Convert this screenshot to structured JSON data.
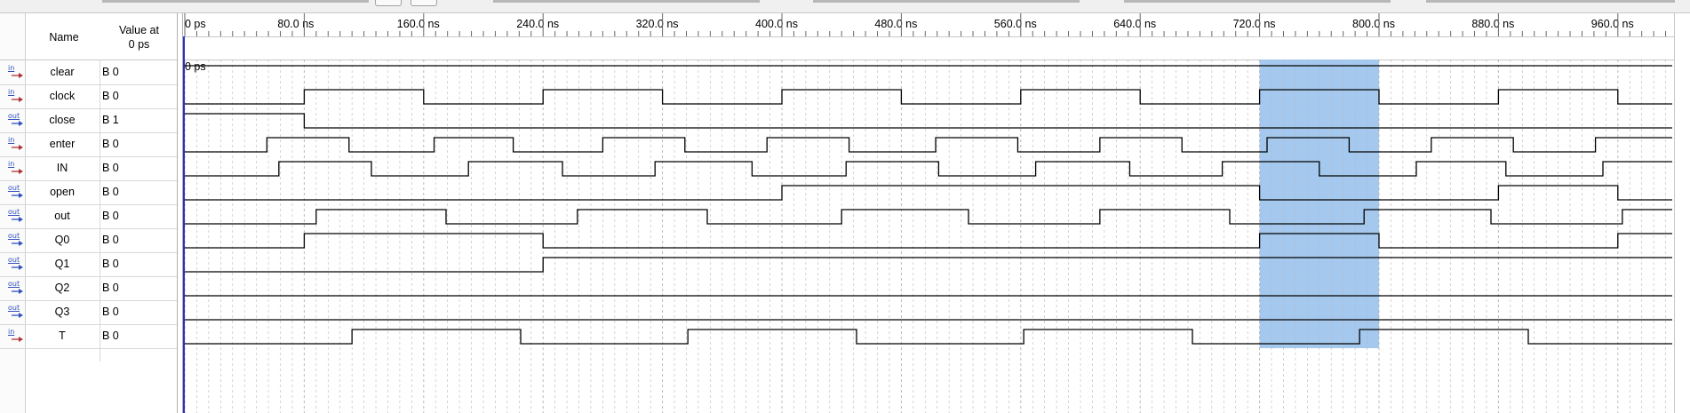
{
  "signal_panel": {
    "name_header": "Name",
    "value_header_line1": "Value at",
    "value_header_line2": "0 ps"
  },
  "signals": [
    {
      "dir": "in",
      "name": "clear",
      "value": "B 0"
    },
    {
      "dir": "in",
      "name": "clock",
      "value": "B 0"
    },
    {
      "dir": "out",
      "name": "close",
      "value": "B 1"
    },
    {
      "dir": "in",
      "name": "enter",
      "value": "B 0"
    },
    {
      "dir": "in",
      "name": "IN",
      "value": "B 0"
    },
    {
      "dir": "out",
      "name": "open",
      "value": "B 0"
    },
    {
      "dir": "out",
      "name": "out",
      "value": "B 0"
    },
    {
      "dir": "out",
      "name": "Q0",
      "value": "B 0"
    },
    {
      "dir": "out",
      "name": "Q1",
      "value": "B 0"
    },
    {
      "dir": "out",
      "name": "Q2",
      "value": "B 0"
    },
    {
      "dir": "out",
      "name": "Q3",
      "value": "B 0"
    },
    {
      "dir": "in",
      "name": "T",
      "value": "B 0"
    }
  ],
  "timeline": {
    "cursor_label": "0 ps",
    "ticks": [
      "0 ps",
      "80.0 ns",
      "160.0 ns",
      "240.0 ns",
      "320.0 ns",
      "400.0 ns",
      "480.0 ns",
      "560.0 ns",
      "640.0 ns",
      "720.0 ns",
      "800.0 ns",
      "880.0 ns",
      "960.0 ns"
    ],
    "tick_values_ns": [
      0,
      80,
      160,
      240,
      320,
      400,
      480,
      560,
      640,
      720,
      800,
      880,
      960
    ],
    "visible_end_ns": 1000,
    "selection_ns": [
      720,
      800
    ],
    "colors": {
      "selection": "#a4c8ee",
      "wave": "#000000",
      "cursor": "#3030c0",
      "grid": "#b8b8b8"
    }
  },
  "waveforms": {
    "clear": {
      "initial": 1,
      "toggles": []
    },
    "clock": {
      "initial": 0,
      "toggles": [
        80,
        160,
        240,
        320,
        400,
        480,
        560,
        640,
        720,
        800,
        880,
        960
      ]
    },
    "close": {
      "initial": 1,
      "toggles": [
        80
      ]
    },
    "enter": {
      "initial": 0,
      "toggles": [
        55,
        110,
        167,
        220,
        280,
        335,
        390,
        445,
        503,
        558,
        613,
        668,
        725,
        780,
        835,
        890,
        945
      ]
    },
    "IN": {
      "initial": 0,
      "toggles": [
        63,
        125,
        190,
        253,
        315,
        380,
        443,
        505,
        570,
        633,
        695,
        760,
        825,
        885,
        950
      ]
    },
    "open": {
      "initial": 0,
      "toggles": [
        400,
        720,
        880,
        960
      ]
    },
    "out": {
      "initial": 0,
      "toggles": [
        88,
        175,
        263,
        350,
        440,
        525,
        613,
        700,
        790,
        875,
        963
      ]
    },
    "Q0": {
      "initial": 0,
      "toggles": [
        80,
        240,
        720,
        800,
        960,
        1040
      ]
    },
    "Q1": {
      "initial": 0,
      "toggles": [
        240,
        1200
      ]
    },
    "Q2": {
      "initial": 0,
      "toggles": []
    },
    "Q3": {
      "initial": 0,
      "toggles": []
    },
    "T": {
      "initial": 0,
      "toggles": [
        112,
        225,
        337,
        450,
        562,
        675,
        787,
        900,
        1012
      ]
    }
  }
}
